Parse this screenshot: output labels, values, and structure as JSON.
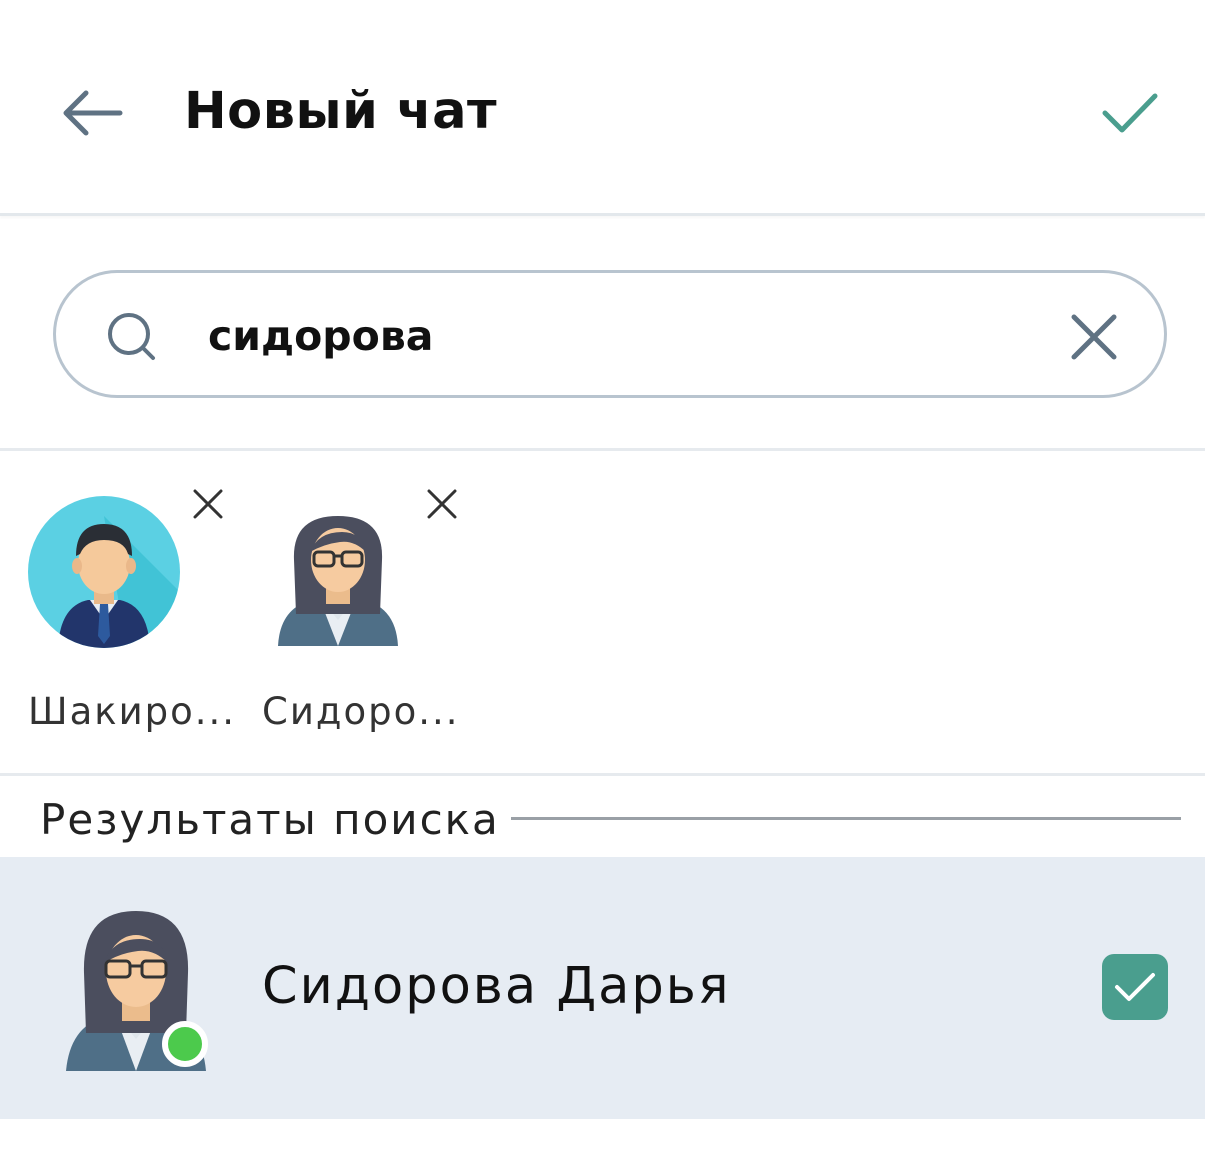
{
  "header": {
    "title": "Новый чат",
    "back_icon": "arrow-left-icon",
    "confirm_icon": "check-icon"
  },
  "search": {
    "value": "сидорова",
    "icon": "search-icon",
    "clear_icon": "close-icon"
  },
  "selected": [
    {
      "name": "Шакиро...",
      "avatar": "male-avatar",
      "remove_icon": "close-icon"
    },
    {
      "name": "Сидоро...",
      "avatar": "female-avatar",
      "remove_icon": "close-icon"
    }
  ],
  "results_section": {
    "title": "Результаты поиска"
  },
  "results": [
    {
      "name": "Сидорова Дарья",
      "avatar": "female-avatar",
      "online": true,
      "checked": true
    }
  ],
  "colors": {
    "accent": "#4a9e8e",
    "online": "#4cca4c",
    "selected_row": "#e6ecf3",
    "search_border": "#b8c4cf"
  }
}
